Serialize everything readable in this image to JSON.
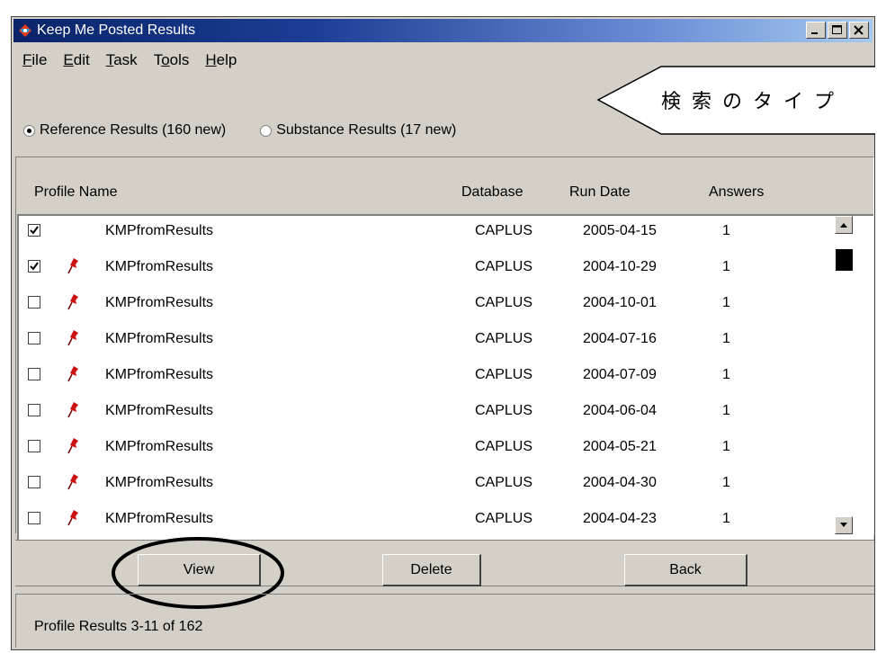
{
  "window": {
    "title": "Keep Me Posted Results"
  },
  "menu": [
    {
      "key": "F",
      "rest": "ile"
    },
    {
      "key": "E",
      "rest": "dit"
    },
    {
      "key": "T",
      "rest": "ask"
    },
    {
      "pre": "T",
      "key": "o",
      "rest": "ols"
    },
    {
      "key": "H",
      "rest": "elp"
    }
  ],
  "callout": {
    "text": "検索のタイプ"
  },
  "result_type": {
    "options": [
      {
        "label": "Reference Results (160 new)",
        "selected": true
      },
      {
        "label": "Substance Results (17 new)",
        "selected": false
      }
    ]
  },
  "columns": {
    "profile": "Profile Name",
    "database": "Database",
    "run_date": "Run Date",
    "answers": "Answers"
  },
  "rows": [
    {
      "checked": true,
      "pinned": false,
      "name": "KMPfromResults",
      "db": "CAPLUS",
      "date": "2005-04-15",
      "answers": "1"
    },
    {
      "checked": true,
      "pinned": true,
      "name": "KMPfromResults",
      "db": "CAPLUS",
      "date": "2004-10-29",
      "answers": "1"
    },
    {
      "checked": false,
      "pinned": true,
      "name": "KMPfromResults",
      "db": "CAPLUS",
      "date": "2004-10-01",
      "answers": "1"
    },
    {
      "checked": false,
      "pinned": true,
      "name": "KMPfromResults",
      "db": "CAPLUS",
      "date": "2004-07-16",
      "answers": "1"
    },
    {
      "checked": false,
      "pinned": true,
      "name": "KMPfromResults",
      "db": "CAPLUS",
      "date": "2004-07-09",
      "answers": "1"
    },
    {
      "checked": false,
      "pinned": true,
      "name": "KMPfromResults",
      "db": "CAPLUS",
      "date": "2004-06-04",
      "answers": "1"
    },
    {
      "checked": false,
      "pinned": true,
      "name": "KMPfromResults",
      "db": "CAPLUS",
      "date": "2004-05-21",
      "answers": "1"
    },
    {
      "checked": false,
      "pinned": true,
      "name": "KMPfromResults",
      "db": "CAPLUS",
      "date": "2004-04-30",
      "answers": "1"
    },
    {
      "checked": false,
      "pinned": true,
      "name": "KMPfromResults",
      "db": "CAPLUS",
      "date": "2004-04-23",
      "answers": "1"
    }
  ],
  "buttons": {
    "view": "View",
    "delete": "Delete",
    "back": "Back"
  },
  "status": "Profile Results 3-11 of 162",
  "colors": {
    "titlebar_start": "#0a246a",
    "titlebar_end": "#a6caf0",
    "face": "#d4d0c8",
    "pin": "#d01010"
  }
}
